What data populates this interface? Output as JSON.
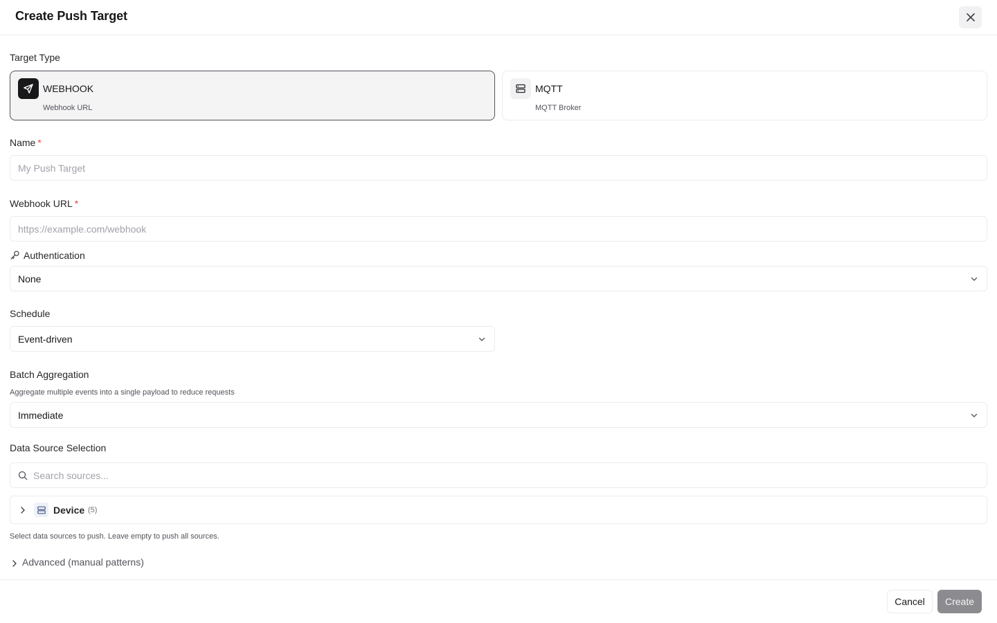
{
  "dialog": {
    "title": "Create Push Target",
    "close_icon": "close-icon"
  },
  "target_type": {
    "label": "Target Type",
    "options": [
      {
        "name": "WEBHOOK",
        "description": "Webhook URL",
        "icon": "send-icon",
        "selected": true
      },
      {
        "name": "MQTT",
        "description": "MQTT Broker",
        "icon": "server-icon",
        "selected": false
      }
    ]
  },
  "name_field": {
    "label": "Name",
    "required_mark": "*",
    "value": "",
    "placeholder": "My Push Target"
  },
  "webhook_url_field": {
    "label": "Webhook URL",
    "required_mark": "*",
    "value": "",
    "placeholder": "https://example.com/webhook"
  },
  "authentication": {
    "label": "Authentication",
    "icon": "key-icon",
    "selected": "None"
  },
  "schedule": {
    "label": "Schedule",
    "selected": "Event-driven"
  },
  "batch_aggregation": {
    "label": "Batch Aggregation",
    "hint": "Aggregate multiple events into a single payload to reduce requests",
    "selected": "Immediate"
  },
  "data_source": {
    "label": "Data Source Selection",
    "search_placeholder": "Search sources...",
    "groups": [
      {
        "name": "Device",
        "count": "(5)",
        "icon": "server-icon",
        "expanded": false
      }
    ],
    "hint": "Select data sources to push. Leave empty to push all sources."
  },
  "advanced": {
    "label": "Advanced (manual patterns)",
    "expanded": false
  },
  "footer": {
    "cancel_label": "Cancel",
    "create_label": "Create"
  },
  "colors": {
    "accent_dark": "#18181b",
    "required": "#ef4444",
    "border": "#ececee",
    "create_disabled": "#8c8c90"
  }
}
